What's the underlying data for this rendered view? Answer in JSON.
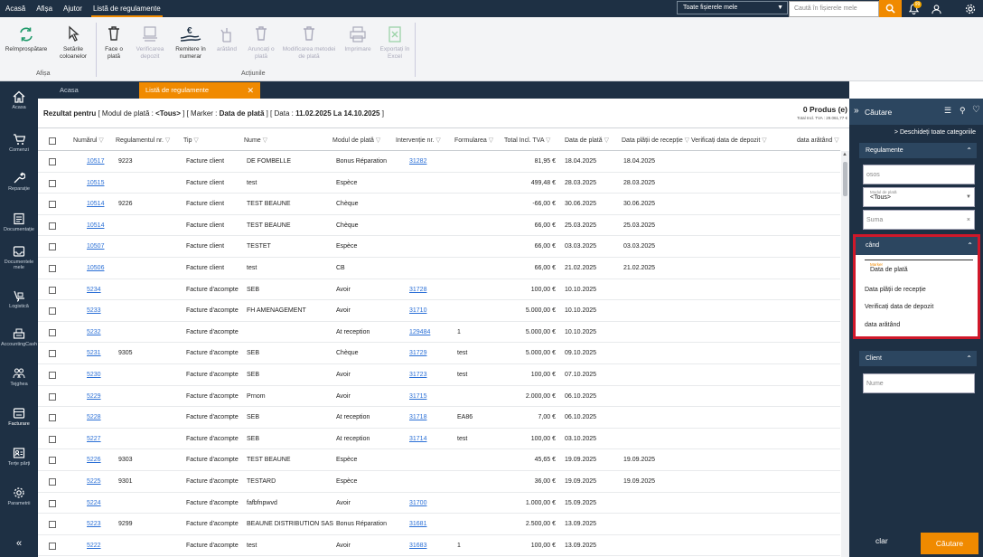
{
  "menubar": {
    "items": [
      "Acasă",
      "Afișa",
      "Ajutor",
      "Listă de regulamente"
    ],
    "file_select": "Toate fișierele mele",
    "search_placeholder": "Caută în fișierele mele",
    "notif_count": "99"
  },
  "ribbon": {
    "refresh": "Reîmprospătare",
    "columns": "Setările coloanelor",
    "group_display": "Afișa",
    "pay": "Face o plată",
    "verify": "Verificarea depozit",
    "remit": "Remitere în numerar",
    "show": "arătând",
    "cancel": "Aruncați o plată",
    "modify": "Modificarea metodei de plată",
    "print": "Imprimare",
    "export": "Exportați în Excel",
    "group_actions": "Acțiunile"
  },
  "leftnav": {
    "items": [
      "Acasa",
      "Comenzi",
      "Reparație",
      "Documentație",
      "Documentele mele",
      "Logistică",
      "AccountingCash",
      "Tejghea",
      "Facturare",
      "Terțe părți",
      "Parametrii"
    ]
  },
  "tabs": {
    "home": "Acasa",
    "list": "Listă de regulamente"
  },
  "result": {
    "prefix": "Rezultat pentru",
    "mode_label": "[ Modul de plată : ",
    "mode_value": "<Tous>",
    "marker_label": " ]  [ Marker : ",
    "marker_value": "Data de plată",
    "date_label": " ]  [ Data : ",
    "date_value": "11.02.2025 La 14.10.2025",
    "date_end": " ]",
    "product_count": "0 Produs (e)",
    "total": "Total Incl. TVA : 29.061,77 €"
  },
  "table": {
    "headers": [
      "Numărul",
      "Regulamentul nr.",
      "Tip",
      "Nume",
      "Modul de plată",
      "Intervenție nr.",
      "Formularea",
      "Total Incl. TVA",
      "Data de plată",
      "Data plății de recepție",
      "Verificați data de depozit",
      "data arătând"
    ],
    "rows": [
      [
        "10517",
        "9223",
        "Facture client",
        "DE FOMBELLE",
        "Bonus Réparation",
        "31282",
        "",
        "81,95 €",
        "18.04.2025",
        "18.04.2025"
      ],
      [
        "10515",
        "",
        "Facture client",
        "test",
        "Espèce",
        "",
        "",
        "499,48 €",
        "28.03.2025",
        "28.03.2025"
      ],
      [
        "10514",
        "9226",
        "Facture client",
        "TEST BEAUNE",
        "Chèque",
        "",
        "",
        "-66,00 €",
        "30.06.2025",
        "30.06.2025"
      ],
      [
        "10514",
        "",
        "Facture client",
        "TEST BEAUNE",
        "Chèque",
        "",
        "",
        "66,00 €",
        "25.03.2025",
        "25.03.2025"
      ],
      [
        "10507",
        "",
        "Facture client",
        "TESTET",
        "Espèce",
        "",
        "",
        "66,00 €",
        "03.03.2025",
        "03.03.2025"
      ],
      [
        "10506",
        "",
        "Facture client",
        "test",
        "CB",
        "",
        "",
        "66,00 €",
        "21.02.2025",
        "21.02.2025"
      ],
      [
        "5234",
        "",
        "Facture d'acompte",
        "SEB",
        "Avoir",
        "31728",
        "",
        "100,00 €",
        "10.10.2025",
        ""
      ],
      [
        "5233",
        "",
        "Facture d'acompte",
        "FH AMENAGEMENT",
        "Avoir",
        "31710",
        "",
        "5.000,00 €",
        "10.10.2025",
        ""
      ],
      [
        "5232",
        "",
        "Facture d'acompte",
        "",
        "At reception",
        "129484",
        "1",
        "5.000,00 €",
        "10.10.2025",
        ""
      ],
      [
        "5231",
        "9305",
        "Facture d'acompte",
        "SEB",
        "Chèque",
        "31729",
        "test",
        "5.000,00 €",
        "09.10.2025",
        ""
      ],
      [
        "5230",
        "",
        "Facture d'acompte",
        "SEB",
        "Avoir",
        "31723",
        "test",
        "100,00 €",
        "07.10.2025",
        ""
      ],
      [
        "5229",
        "",
        "Facture d'acompte",
        "Prnom",
        "Avoir",
        "31715",
        "",
        "2.000,00 €",
        "06.10.2025",
        ""
      ],
      [
        "5228",
        "",
        "Facture d'acompte",
        "SEB",
        "At reception",
        "31718",
        "EA86",
        "7,00 €",
        "06.10.2025",
        ""
      ],
      [
        "5227",
        "",
        "Facture d'acompte",
        "SEB",
        "At reception",
        "31714",
        "test",
        "100,00 €",
        "03.10.2025",
        ""
      ],
      [
        "5226",
        "9303",
        "Facture d'acompte",
        "TEST BEAUNE",
        "Espèce",
        "",
        "",
        "45,65 €",
        "19.09.2025",
        "19.09.2025"
      ],
      [
        "5225",
        "9301",
        "Facture d'acompte",
        "TESTARD",
        "Espèce",
        "",
        "",
        "36,00 €",
        "19.09.2025",
        "19.09.2025"
      ],
      [
        "5224",
        "",
        "Facture d'acompte",
        "fafbfnpwvd",
        "Avoir",
        "31700",
        "",
        "1.000,00 €",
        "15.09.2025",
        ""
      ],
      [
        "5223",
        "9299",
        "Facture d'acompte",
        "BEAUNE DISTRIBUTION SAS",
        "Bonus Réparation",
        "31681",
        "",
        "2.500,00 €",
        "13.09.2025",
        ""
      ],
      [
        "5222",
        "",
        "Facture d'acompte",
        "test",
        "Avoir",
        "31683",
        "1",
        "100,00 €",
        "13.09.2025",
        ""
      ]
    ]
  },
  "search_panel": {
    "title": "Căutare",
    "expand_all": "Deschideți toate categoriile",
    "sec_regulations": "Regulamente",
    "input_osos": "osos",
    "mode_label": "Modul de plată",
    "mode_value": "<Tous>",
    "sum_placeholder": "Suma",
    "sec_when": "când",
    "marker_label": "Marker",
    "marker_value": "Data de plată",
    "opt_reception": "Data plății de recepție",
    "opt_deposit": "Verificați data de depozit",
    "opt_showing": "data arătând",
    "sec_client": "Client",
    "name_placeholder": "Nume",
    "clear": "clar",
    "search": "Căutare"
  },
  "colors": {
    "accent": "#f08a00",
    "navy": "#1e3044",
    "link": "#2a6fd6",
    "highlight": "#d0182a"
  }
}
